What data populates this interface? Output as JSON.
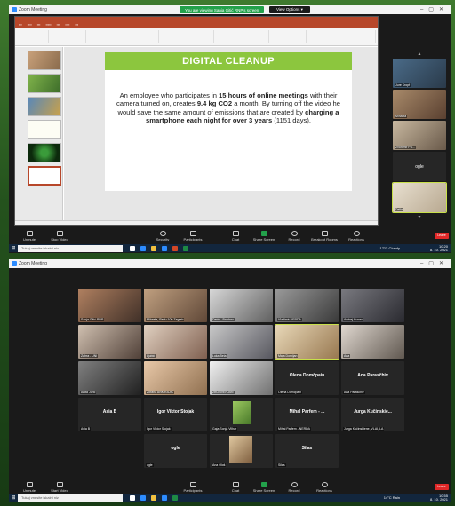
{
  "top_window": {
    "title": "Zoom Meeting",
    "share_banner": "You are viewing Sanja Gitić RNP's screen",
    "view_options": "View Options ▾",
    "slide": {
      "heading": "DIGITAL CLEANUP",
      "body_1": "An employee who participates in ",
      "body_bold_1": "15 hours of online meetings",
      "body_2": " with their camera turned on, creates ",
      "body_bold_2": "9.4 kg CO2",
      "body_3": " a month. By turning off the video he would save the same amount of emissions that are created by ",
      "body_bold_3": "charging a smartphone each night for over 3 years",
      "body_4": " (1151 days)."
    },
    "notes_label": "Klikněte sem a přidejte poznámky",
    "strip": [
      {
        "name": "Jure Kropf"
      },
      {
        "name": "Mihaela"
      },
      {
        "name": "Zvonimir Pa..."
      },
      {
        "name": "ogle"
      },
      {
        "name": "Dalia"
      }
    ],
    "toolbar": {
      "unmute": "Unmute",
      "start_video": "Stop Video",
      "security": "Security",
      "participants": "Participants",
      "participants_count": "26",
      "chat": "Chat",
      "share": "Share Screen",
      "record": "Record",
      "breakout": "Breakout Rooms",
      "reactions": "Reactions",
      "leave": "Leave"
    },
    "taskbar": {
      "search": "Tukaj vnesite iskalni niz",
      "weather": "17°C Cloudy",
      "time": "10:20",
      "date": "8. 10. 2021"
    }
  },
  "bottom_window": {
    "title": "Zoom Meeting",
    "tiles": [
      {
        "name": "Sanja Gitić RNP"
      },
      {
        "name": "Mihaela, Redu 100 Zagreb"
      },
      {
        "name": "Dario - Bradaro"
      },
      {
        "name": "Vladimir NERDA"
      },
      {
        "name": "Andrej Kunec"
      },
      {
        "name": "Zahra - UNI"
      },
      {
        "name": "Ljubić"
      },
      {
        "name": "Luka Bela"
      },
      {
        "name": "Maja Domljan"
      },
      {
        "name": "Ana"
      },
      {
        "name": "Anita Jurić"
      },
      {
        "name": "Zorana ANKIRAJIĆ"
      },
      {
        "name": "ZBONVENJAN"
      },
      {
        "name": "Olena Domčpain",
        "label": "Olena Domčpain"
      },
      {
        "name": "Ana Parasčhiv",
        "label": "Ana Parasčhiv"
      },
      {
        "name": "Asia B",
        "label": "Asia B"
      },
      {
        "name": "Igor Viktor Stojak",
        "label": "Igor Viktor Stojak"
      },
      {
        "name": "Gaja Sonja Vilhar"
      },
      {
        "name": "Mihal Parfem - NERDA",
        "label": "Mihal Parfem - ..."
      },
      {
        "name": "Jurga Kučinskiene, VLAI, LA",
        "label": "Jurga Kučinskie..."
      },
      {
        "name": "ogle",
        "label": "ogle"
      },
      {
        "name": "Ana Ološ"
      },
      {
        "name": "Silas",
        "label": "Silas"
      }
    ],
    "toolbar": {
      "unmute": "Unmute",
      "start_video": "Start Video",
      "participants": "Participants",
      "participants_count": "25",
      "chat": "Chat",
      "share": "Share Screen",
      "record": "Record",
      "reactions": "Reactions",
      "leave": "Leave"
    },
    "taskbar": {
      "search": "Tukaj vnesite iskalni niz",
      "weather": "14°C Rain",
      "time": "10:55",
      "date": "8. 10. 2021"
    }
  }
}
